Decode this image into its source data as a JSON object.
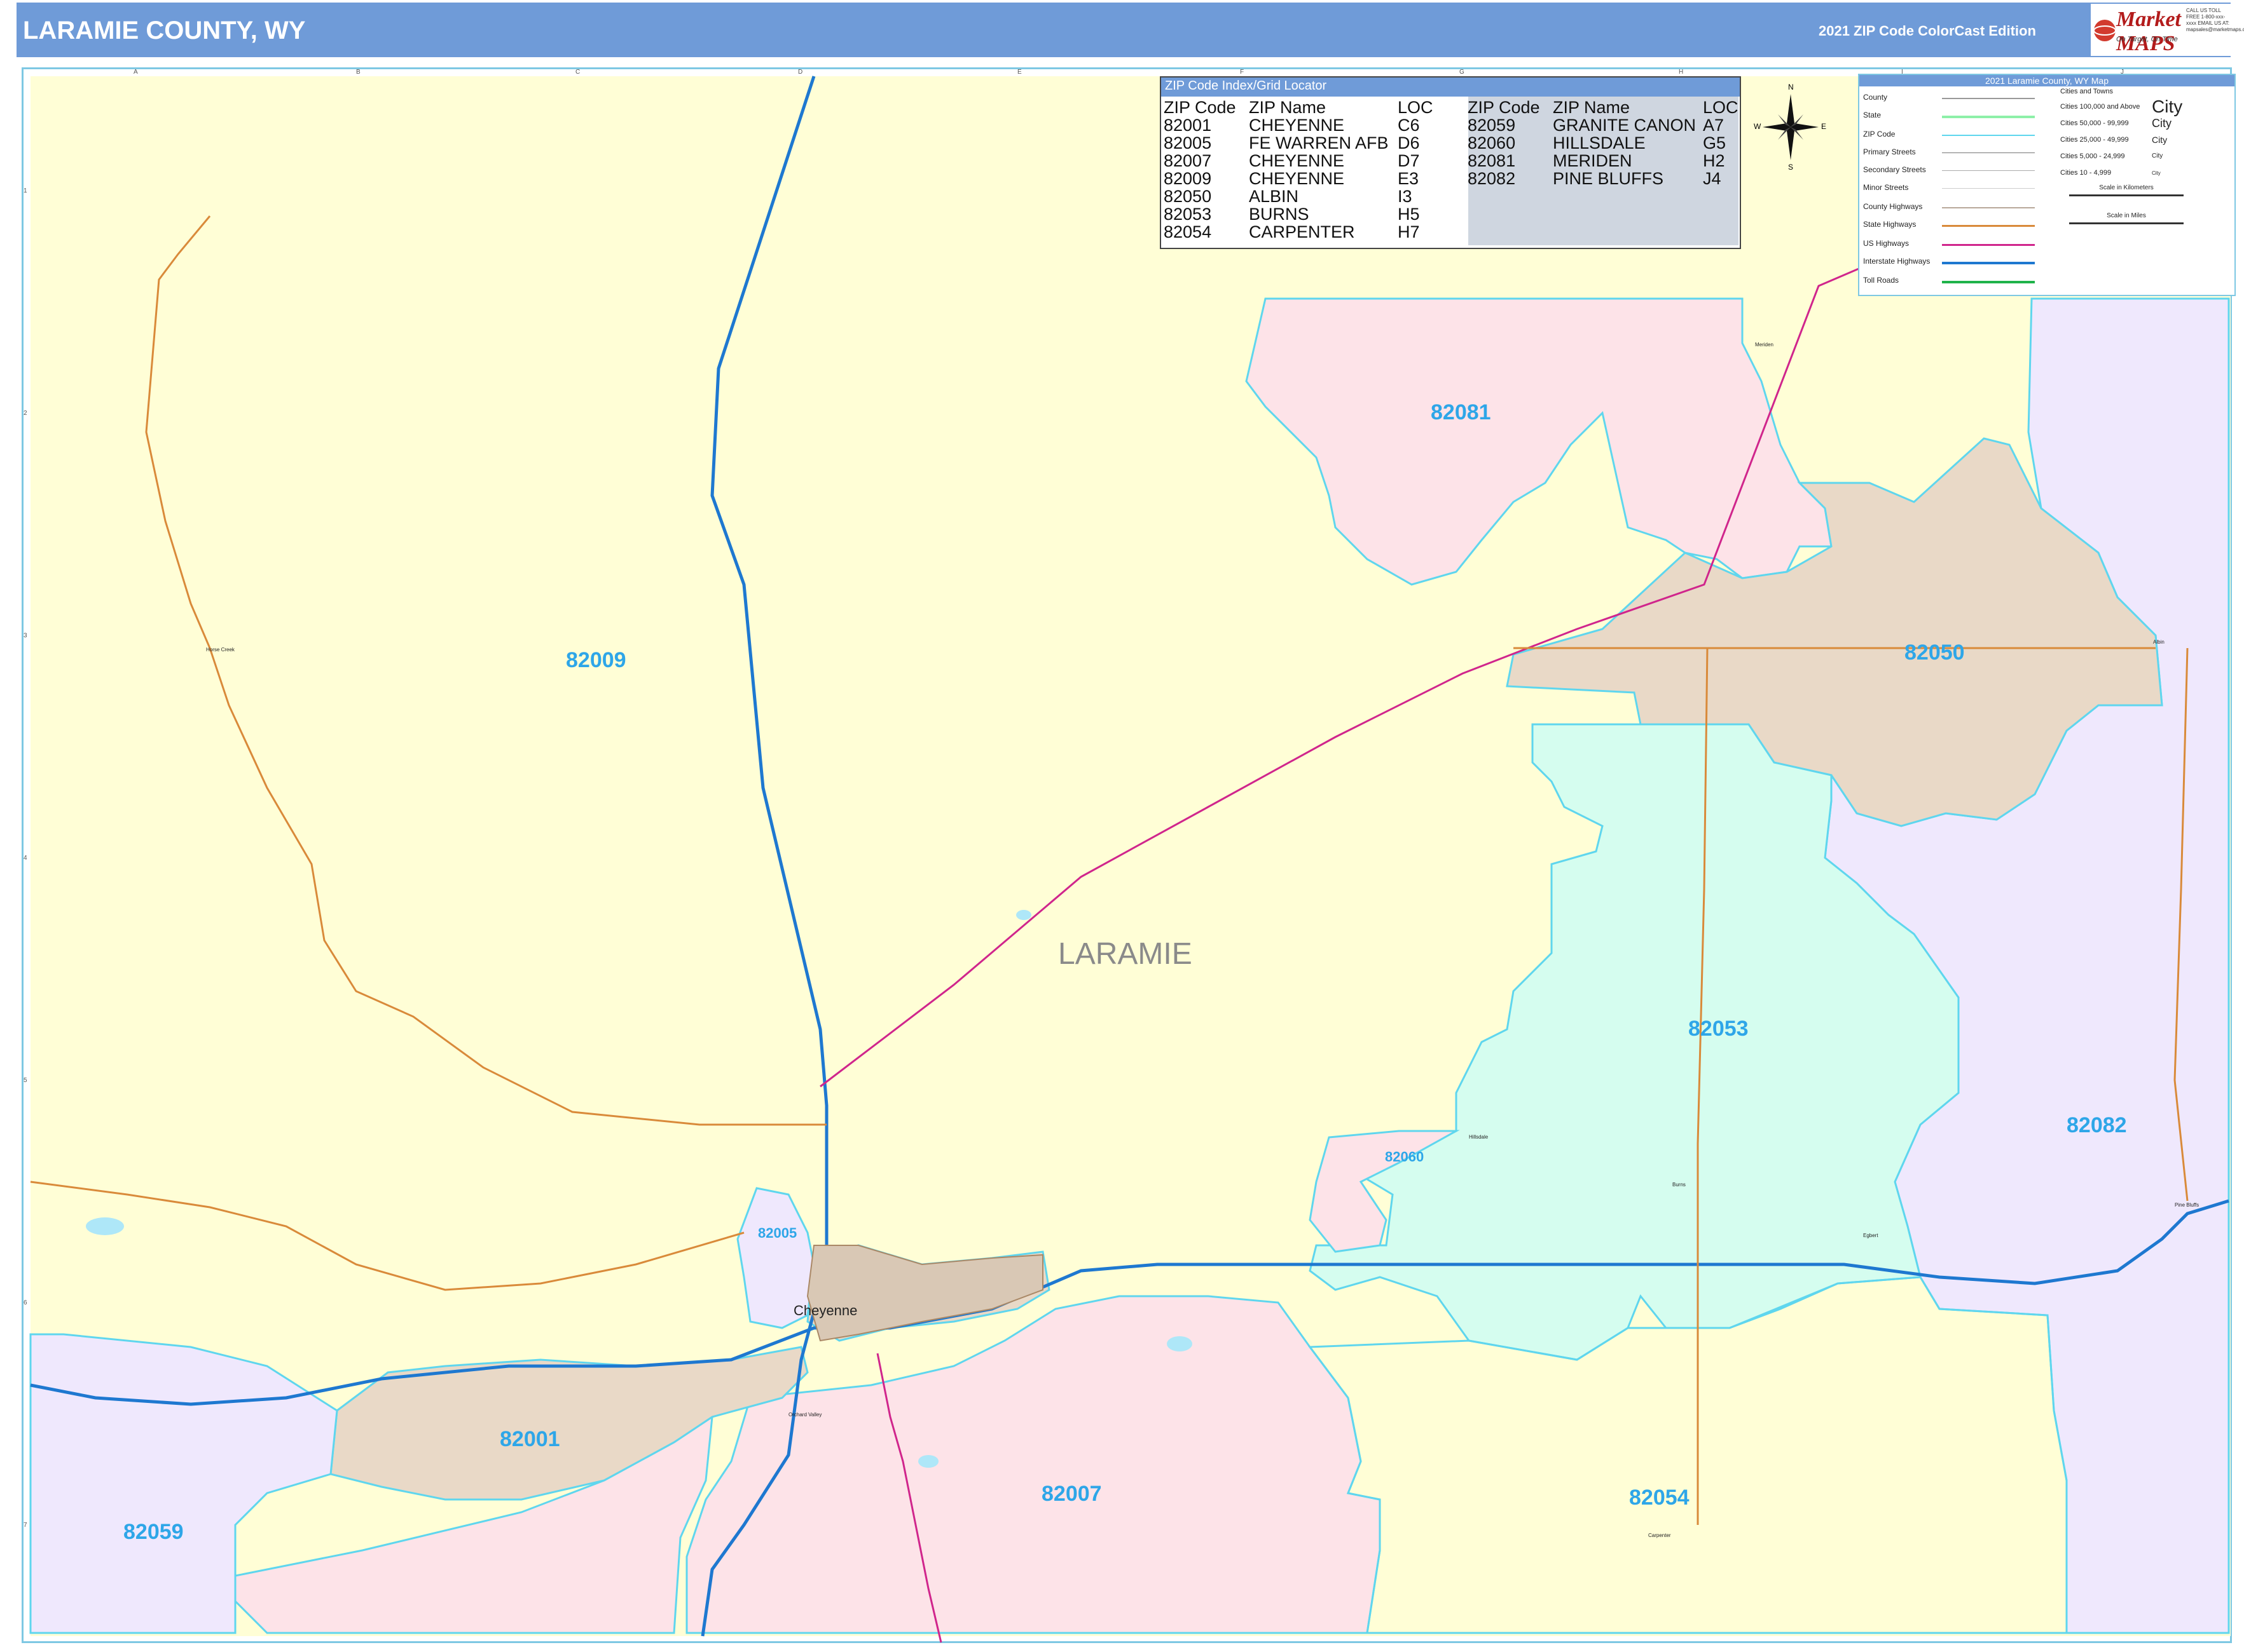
{
  "header": {
    "title": "LARAMIE COUNTY, WY",
    "edition": "2021 ZIP Code ColorCast Edition",
    "logo": {
      "name": "Market MAPS",
      "tagline": "On Target, On Time",
      "subtitle": "America's Leading Source of Business Maps",
      "contact": "CALL US TOLL FREE 1-800-xxx-xxxx EMAIL US AT: mapsales@marketmaps.com"
    }
  },
  "map": {
    "county_name": "LARAMIE",
    "colors": {
      "yellow": "#fffed6",
      "pink": "#fde3e8",
      "mint": "#d5fdef",
      "tan": "#e9d9c7",
      "lavender": "#efe8fd",
      "interstate": "#1e78d0",
      "us_highway": "#d0258c",
      "state_highway": "#d98a3a",
      "zip_boundary": "#5fd6ee"
    },
    "zip_labels": [
      {
        "zip": "82009"
      },
      {
        "zip": "82081"
      },
      {
        "zip": "82050"
      },
      {
        "zip": "82053"
      },
      {
        "zip": "82082"
      },
      {
        "zip": "82060"
      },
      {
        "zip": "82005"
      },
      {
        "zip": "82001"
      },
      {
        "zip": "82007"
      },
      {
        "zip": "82054"
      },
      {
        "zip": "82059"
      }
    ],
    "cities": [
      {
        "name": "Cheyenne"
      },
      {
        "name": "Horse Creek"
      },
      {
        "name": "Meriden"
      },
      {
        "name": "Albin"
      },
      {
        "name": "Burns"
      },
      {
        "name": "Egbert"
      },
      {
        "name": "Pine Bluffs"
      },
      {
        "name": "Carpenter"
      },
      {
        "name": "Hillsdale"
      },
      {
        "name": "Orchard Valley"
      }
    ],
    "grid_columns": [
      "A",
      "B",
      "C",
      "D",
      "E",
      "F",
      "G",
      "H",
      "I",
      "J"
    ],
    "grid_rows": [
      "1",
      "2",
      "3",
      "4",
      "5",
      "6",
      "7"
    ]
  },
  "zip_index": {
    "title": "ZIP Code Index/Grid Locator",
    "headers": {
      "zip": "ZIP Code",
      "name": "ZIP Name",
      "loc": "LOC"
    },
    "left": [
      {
        "zip": "82001",
        "name": "CHEYENNE",
        "loc": "C6"
      },
      {
        "zip": "82005",
        "name": "FE WARREN AFB",
        "loc": "D6"
      },
      {
        "zip": "82007",
        "name": "CHEYENNE",
        "loc": "D7"
      },
      {
        "zip": "82009",
        "name": "CHEYENNE",
        "loc": "E3"
      },
      {
        "zip": "82050",
        "name": "ALBIN",
        "loc": "I3"
      },
      {
        "zip": "82053",
        "name": "BURNS",
        "loc": "H5"
      },
      {
        "zip": "82054",
        "name": "CARPENTER",
        "loc": "H7"
      }
    ],
    "right": [
      {
        "zip": "82059",
        "name": "GRANITE CANON",
        "loc": "A7"
      },
      {
        "zip": "82060",
        "name": "HILLSDALE",
        "loc": "G5"
      },
      {
        "zip": "82081",
        "name": "MERIDEN",
        "loc": "H2"
      },
      {
        "zip": "82082",
        "name": "PINE BLUFFS",
        "loc": "J4"
      }
    ]
  },
  "compass": {
    "n": "N",
    "s": "S",
    "e": "E",
    "w": "W"
  },
  "legend": {
    "title": "2021 Laramie County, WY Map",
    "road_types": [
      "County",
      "State",
      "ZIP Code",
      "Primary Streets",
      "Secondary Streets",
      "Minor Streets",
      "County Highways",
      "State Highways",
      "US Highways",
      "Interstate Highways",
      "Toll Roads"
    ],
    "city_header": "Cities and Towns",
    "city_sizes": [
      {
        "label": "Cities 100,000 and Above",
        "sample": "City"
      },
      {
        "label": "Cities 50,000 - 99,999",
        "sample": "City"
      },
      {
        "label": "Cities 25,000 - 49,999",
        "sample": "City"
      },
      {
        "label": "Cities 5,000 - 24,999",
        "sample": "City"
      },
      {
        "label": "Cities 10 - 4,999",
        "sample": "City"
      }
    ],
    "scale_km": "Scale in Kilometers",
    "scale_mi": "Scale in Miles"
  }
}
